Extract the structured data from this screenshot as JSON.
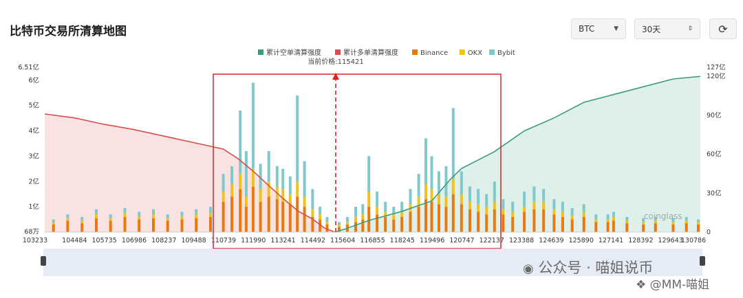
{
  "header": {
    "title": "比特币交易所清算地图",
    "coin_select": "BTC",
    "range_select": "30天"
  },
  "colors": {
    "short": "#3a9c7c",
    "long": "#d64d4d",
    "binance": "#e9790f",
    "okx": "#f0c21b",
    "bybit": "#7ec9cc",
    "highlight_box": "#d8221f"
  },
  "watermark": {
    "brand": "coinglass",
    "line1": "公众号 · 喵姐说币",
    "line2": "@MM-喵姐"
  },
  "chart_data": {
    "type": "bar",
    "title": "",
    "current_price_label": "当前价格:115421",
    "current_price": 115421,
    "legend": [
      "累计空单清算强度",
      "累计多单清算强度",
      "Binance",
      "OKX",
      "Bybit"
    ],
    "legend_position": "top-center",
    "x_ticks": [
      "103233",
      "104484",
      "105735",
      "106986",
      "108237",
      "109488",
      "110739",
      "111990",
      "113241",
      "114492",
      "115604",
      "116855",
      "118245",
      "119496",
      "120747",
      "122137",
      "123388",
      "124639",
      "125890",
      "127141",
      "128392",
      "129643",
      "130786"
    ],
    "x_range": [
      103233,
      130786
    ],
    "y_left": {
      "ticks": [
        "68万",
        "1亿",
        "2亿",
        "3亿",
        "4亿",
        "5亿",
        "6亿",
        "6.51亿"
      ],
      "range": [
        0.0068,
        6.51
      ],
      "unit": "亿"
    },
    "y_right": {
      "ticks": [
        "0",
        "30亿",
        "60亿",
        "90亿",
        "120亿",
        "127亿"
      ],
      "range": [
        0,
        127
      ],
      "unit": "亿"
    },
    "cumulative_long": {
      "name": "累计多单清算强度",
      "x": [
        103233,
        104484,
        105735,
        106986,
        108237,
        109488,
        110739,
        111400,
        111990,
        112700,
        113241,
        113900,
        114492,
        115000,
        115421
      ],
      "y": [
        91,
        88,
        83,
        79,
        74,
        69,
        64,
        56,
        47,
        35,
        26,
        16,
        10,
        3,
        0
      ]
    },
    "cumulative_short": {
      "name": "累计空单清算强度",
      "x": [
        115421,
        115800,
        116855,
        118245,
        119496,
        120300,
        120747,
        122137,
        123388,
        124639,
        125890,
        127141,
        128392,
        129643,
        130786
      ],
      "y": [
        0,
        2,
        9,
        16,
        24,
        41,
        49,
        62,
        78,
        88,
        100,
        106,
        112,
        118,
        120
      ]
    },
    "bars": {
      "x": [
        103600,
        104200,
        104800,
        105400,
        106000,
        106600,
        107200,
        107800,
        108400,
        109000,
        109600,
        110200,
        110739,
        111100,
        111450,
        111700,
        111990,
        112300,
        112650,
        113000,
        113241,
        113550,
        113850,
        114150,
        114492,
        114800,
        115100,
        115604,
        115950,
        116300,
        116600,
        116855,
        117200,
        117550,
        117900,
        118245,
        118600,
        118950,
        119250,
        119496,
        119800,
        120100,
        120400,
        120747,
        121100,
        121450,
        121800,
        122137,
        122500,
        122900,
        123388,
        123800,
        124200,
        124639,
        125000,
        125400,
        125890,
        126400,
        126900,
        127141,
        127700,
        128392,
        128900,
        129643,
        130200,
        130700
      ],
      "series": [
        {
          "name": "Binance",
          "values": [
            0.3,
            0.45,
            0.35,
            0.55,
            0.45,
            0.6,
            0.5,
            0.55,
            0.45,
            0.5,
            0.55,
            0.6,
            1.2,
            1.4,
            1.7,
            1.0,
            1.8,
            1.2,
            1.4,
            1.3,
            1.2,
            1.1,
            1.4,
            1.0,
            0.6,
            0.5,
            0.3,
            0.2,
            0.3,
            0.4,
            0.5,
            1.0,
            0.7,
            0.6,
            0.5,
            0.6,
            0.8,
            1.0,
            1.3,
            1.2,
            1.1,
            1.0,
            1.5,
            1.1,
            0.9,
            0.8,
            0.7,
            0.9,
            0.7,
            0.6,
            0.8,
            0.9,
            0.9,
            0.7,
            0.6,
            0.5,
            0.6,
            0.4,
            0.4,
            0.45,
            0.35,
            0.3,
            0.35,
            0.3,
            0.35,
            0.3
          ]
        },
        {
          "name": "OKX",
          "values": [
            0.08,
            0.1,
            0.1,
            0.15,
            0.1,
            0.15,
            0.12,
            0.15,
            0.1,
            0.12,
            0.15,
            0.15,
            0.4,
            0.5,
            0.6,
            0.4,
            0.7,
            0.5,
            0.6,
            0.5,
            0.5,
            0.4,
            0.6,
            0.4,
            0.3,
            0.2,
            0.1,
            0.1,
            0.1,
            0.2,
            0.2,
            0.6,
            0.3,
            0.2,
            0.2,
            0.2,
            0.3,
            0.4,
            0.6,
            0.5,
            0.4,
            0.4,
            0.6,
            0.4,
            0.3,
            0.3,
            0.3,
            0.3,
            0.2,
            0.2,
            0.2,
            0.3,
            0.3,
            0.2,
            0.2,
            0.15,
            0.2,
            0.1,
            0.1,
            0.15,
            0.1,
            0.1,
            0.1,
            0.1,
            0.1,
            0.1
          ]
        },
        {
          "name": "Bybit",
          "values": [
            0.12,
            0.15,
            0.15,
            0.2,
            0.15,
            0.2,
            0.18,
            0.2,
            0.15,
            0.18,
            0.2,
            0.25,
            0.7,
            0.7,
            2.5,
            1.8,
            3.4,
            1.0,
            1.2,
            0.8,
            0.8,
            0.7,
            3.4,
            1.4,
            0.8,
            0.3,
            0.2,
            0.1,
            0.2,
            0.4,
            0.4,
            1.4,
            0.6,
            0.4,
            0.3,
            0.4,
            0.6,
            0.9,
            1.8,
            1.3,
            0.9,
            1.2,
            2.8,
            0.9,
            0.6,
            0.6,
            0.5,
            0.8,
            0.4,
            0.4,
            0.6,
            0.6,
            0.5,
            0.4,
            0.4,
            0.3,
            0.3,
            0.2,
            0.2,
            0.2,
            0.15,
            0.15,
            0.15,
            0.15,
            0.15,
            0.1
          ]
        }
      ]
    }
  }
}
